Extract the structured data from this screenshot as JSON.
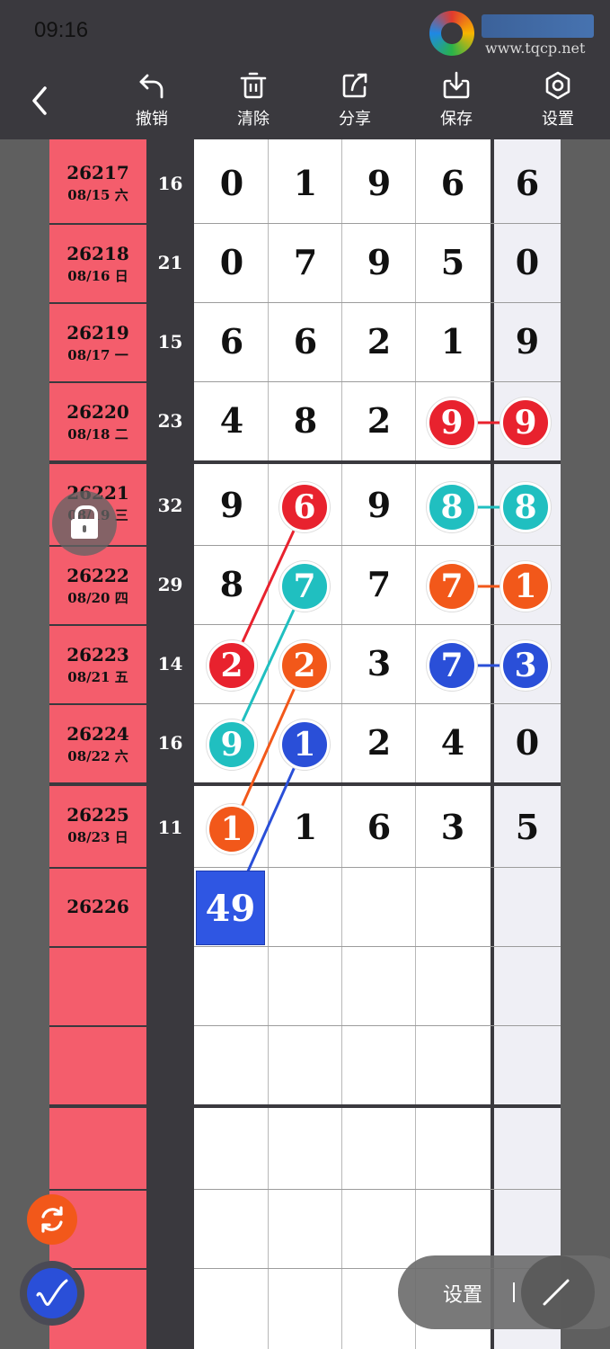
{
  "status_bar": {
    "time": "09:16"
  },
  "logo": {
    "site": "www.tqcp.net"
  },
  "toolbar": {
    "undo_label": "撤销",
    "clear_label": "清除",
    "share_label": "分享",
    "save_label": "保存",
    "settings_label": "设置"
  },
  "rows": [
    {
      "id": "26217",
      "date": "08/15 六",
      "sum": "16",
      "digits": [
        "0",
        "1",
        "9",
        "6"
      ],
      "extra": "6"
    },
    {
      "id": "26218",
      "date": "08/16 日",
      "sum": "21",
      "digits": [
        "0",
        "7",
        "9",
        "5"
      ],
      "extra": "0"
    },
    {
      "id": "26219",
      "date": "08/17 一",
      "sum": "15",
      "digits": [
        "6",
        "6",
        "2",
        "1"
      ],
      "extra": "9"
    },
    {
      "id": "26220",
      "date": "08/18 二",
      "sum": "23",
      "digits": [
        "4",
        "8",
        "2",
        "9"
      ],
      "extra": "9"
    },
    {
      "id": "26221",
      "date": "08/19 三",
      "sum": "32",
      "digits": [
        "9",
        "6",
        "9",
        "8"
      ],
      "extra": "8"
    },
    {
      "id": "26222",
      "date": "08/20 四",
      "sum": "29",
      "digits": [
        "8",
        "7",
        "7",
        "7"
      ],
      "extra": "1"
    },
    {
      "id": "26223",
      "date": "08/21 五",
      "sum": "14",
      "digits": [
        "2",
        "2",
        "3",
        "7"
      ],
      "extra": "3"
    },
    {
      "id": "26224",
      "date": "08/22 六",
      "sum": "16",
      "digits": [
        "9",
        "1",
        "2",
        "4"
      ],
      "extra": "0"
    },
    {
      "id": "26225",
      "date": "08/23 日",
      "sum": "11",
      "digits": [
        "1",
        "1",
        "6",
        "3"
      ],
      "extra": "5"
    },
    {
      "id": "26226",
      "date": "",
      "sum": "",
      "digits": [
        "",
        "",
        "",
        ""
      ],
      "extra": ""
    }
  ],
  "highlight_box": "49",
  "floating": {
    "settings_pill_label": "设置"
  },
  "colors": {
    "red": "#e8222e",
    "teal": "#20bfc0",
    "orange": "#f2581a",
    "blue": "#2a4fd8",
    "id_column": "#f45d6c"
  }
}
